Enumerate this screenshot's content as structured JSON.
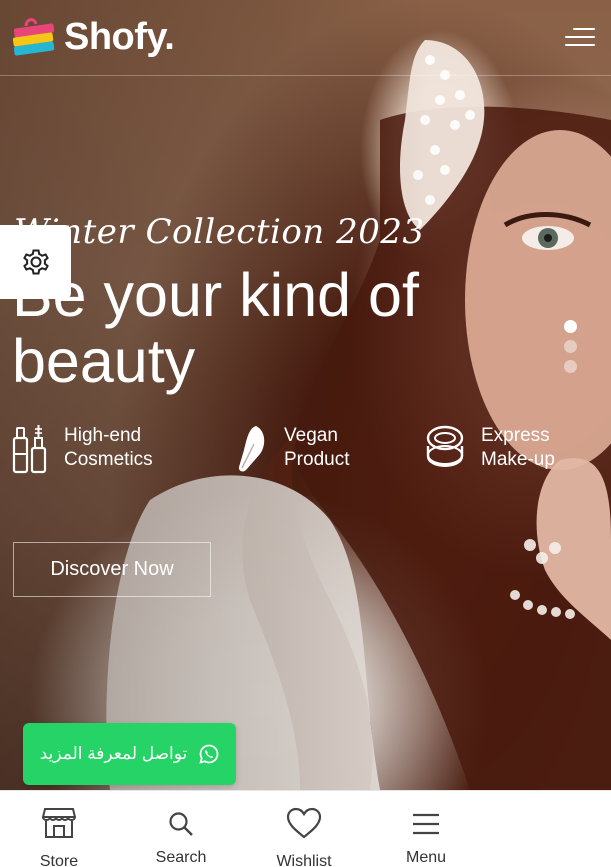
{
  "header": {
    "logo_text": "Shofy.",
    "logo_icon": "shopping-bag-icon",
    "menu_icon": "hamburger-menu-icon"
  },
  "hero": {
    "subtitle": "Winter Collection 2023",
    "title": "Be your kind of beauty",
    "features": [
      {
        "icon": "cosmetics-icon",
        "line1": "High-end",
        "line2": "Cosmetics"
      },
      {
        "icon": "vegan-leaf-icon",
        "line1": "Vegan",
        "line2": "Product"
      },
      {
        "icon": "makeup-compact-icon",
        "line1": "Express",
        "line2": "Make-up"
      }
    ],
    "cta_label": "Discover Now",
    "slider": {
      "slides": 3,
      "active_index": 0
    }
  },
  "settings": {
    "icon": "gear-icon"
  },
  "whatsapp": {
    "label": "تواصل لمعرفة المزيد",
    "icon": "whatsapp-icon",
    "color": "#25d366"
  },
  "bottom_nav": {
    "items": [
      {
        "label": "Store",
        "icon": "store-icon"
      },
      {
        "label": "Search",
        "icon": "search-icon"
      },
      {
        "label": "Wishlist",
        "icon": "heart-icon"
      },
      {
        "label": "Menu",
        "icon": "menu-icon"
      }
    ]
  }
}
